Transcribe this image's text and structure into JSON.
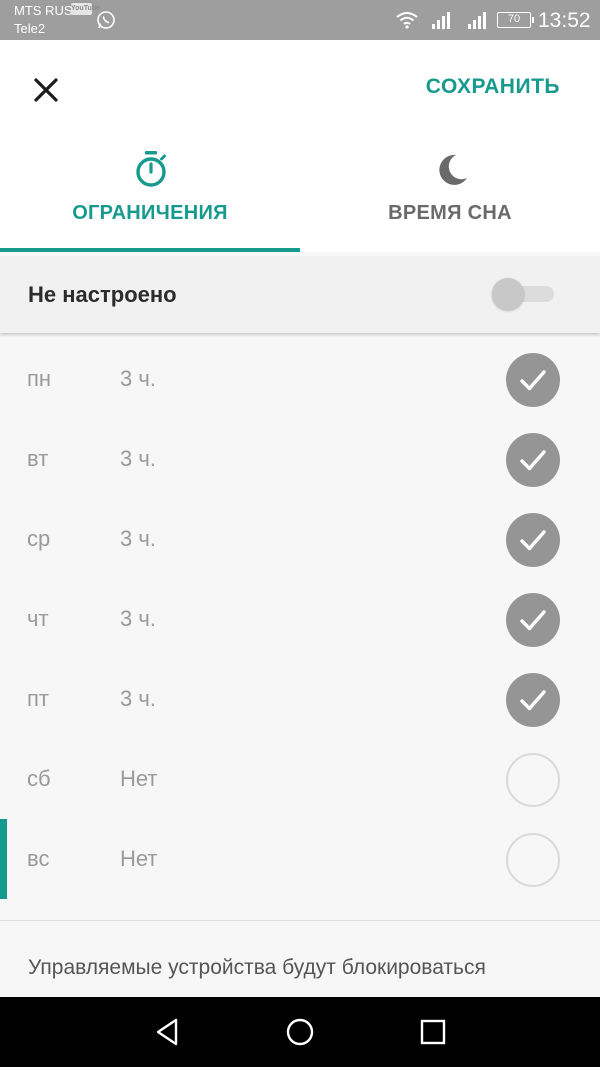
{
  "status_bar": {
    "carrier_1": "MTS RUS",
    "carrier_1_badge": "YouTube",
    "carrier_2": "Tele2",
    "battery": "70",
    "time": "13:52"
  },
  "toolbar": {
    "close_icon": "close-icon",
    "save_label": "СОХРАНИТЬ"
  },
  "tabs": [
    {
      "label": "ОГРАНИЧЕНИЯ",
      "icon": "timer-icon",
      "active": true
    },
    {
      "label": "ВРЕМЯ СНА",
      "icon": "moon-icon",
      "active": false
    }
  ],
  "status": {
    "label": "Не настроено",
    "toggle_on": false
  },
  "days": [
    {
      "name": "пн",
      "value": "3 ч.",
      "checked": true
    },
    {
      "name": "вт",
      "value": "3 ч.",
      "checked": true
    },
    {
      "name": "ср",
      "value": "3 ч.",
      "checked": true
    },
    {
      "name": "чт",
      "value": "3 ч.",
      "checked": true
    },
    {
      "name": "пт",
      "value": "3 ч.",
      "checked": true
    },
    {
      "name": "сб",
      "value": "Нет",
      "checked": false
    },
    {
      "name": "вс",
      "value": "Нет",
      "checked": false
    }
  ],
  "description": "Управляемые устройства будут блокироваться",
  "colors": {
    "accent": "#179a8e",
    "status_bar": "#9e9e9e",
    "check_on": "#959595"
  },
  "nav": {
    "back_icon": "back-icon",
    "home_icon": "home-icon",
    "recents_icon": "recents-icon"
  }
}
